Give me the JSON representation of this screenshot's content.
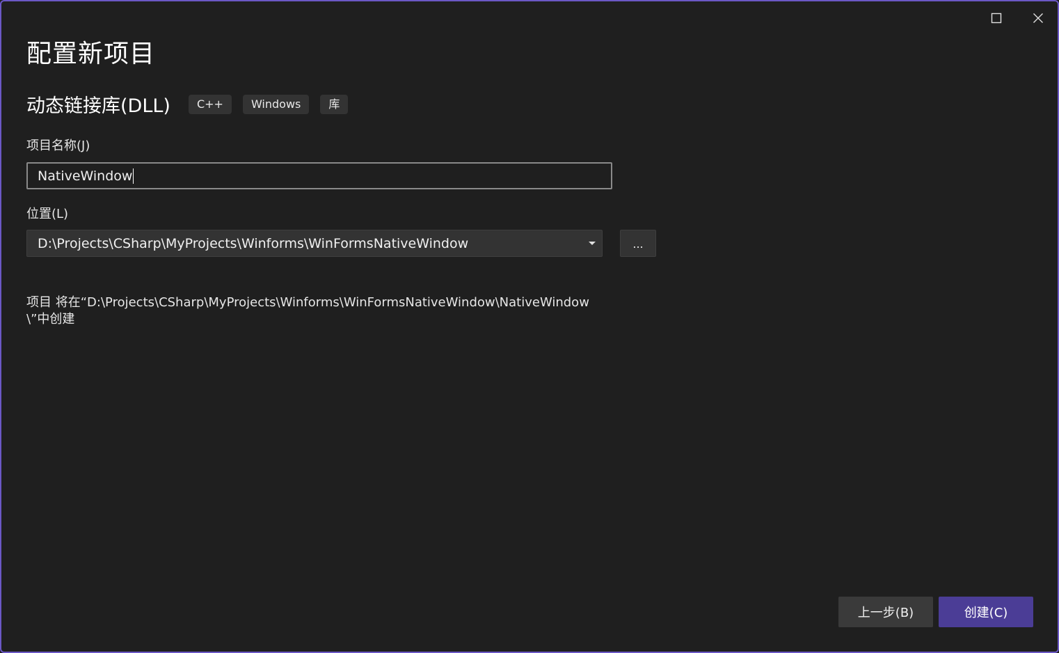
{
  "window": {
    "title": "配置新项目",
    "controls": {
      "maximize_icon": "maximize-icon",
      "close_icon": "close-icon"
    }
  },
  "template": {
    "name": "动态链接库(DLL)",
    "tags": [
      "C++",
      "Windows",
      "库"
    ]
  },
  "project_name": {
    "label": "项目名称(J)",
    "value": "NativeWindow"
  },
  "location": {
    "label": "位置(L)",
    "value": "D:\\Projects\\CSharp\\MyProjects\\Winforms\\WinFormsNativeWindow",
    "browse_label": "..."
  },
  "info": {
    "text": "项目 将在“D:\\Projects\\CSharp\\MyProjects\\Winforms\\WinFormsNativeWindow\\NativeWindow\\”中创建"
  },
  "footer": {
    "back_label": "上一步(B)",
    "create_label": "创建(C)"
  },
  "colors": {
    "background": "#1f1f1f",
    "accent": "#4b3d96",
    "window_border": "#6b58c5"
  }
}
